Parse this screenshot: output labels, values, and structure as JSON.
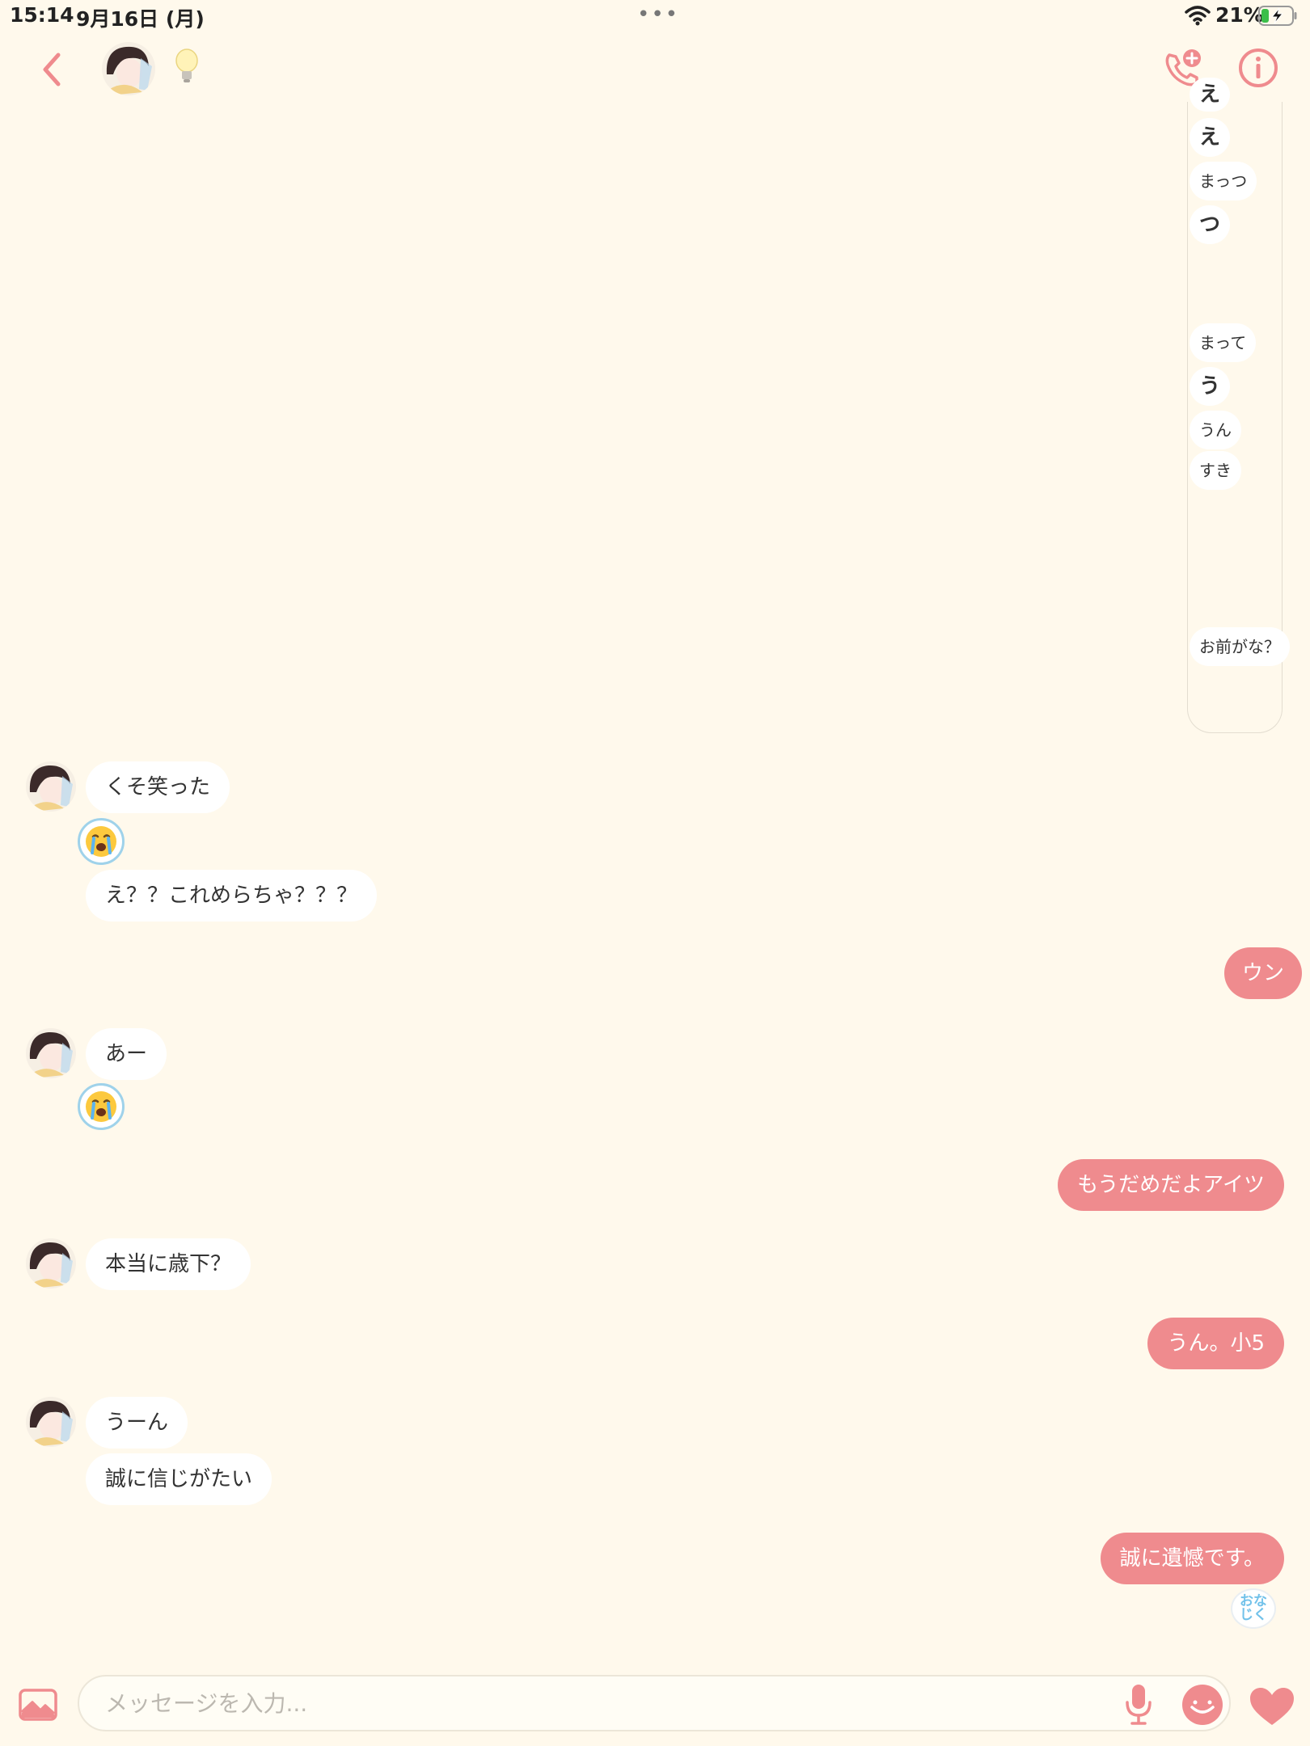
{
  "status_bar": {
    "time": "15:14",
    "date": "9月16日 (月)",
    "battery_percent": "21%",
    "battery_level": 0.21,
    "charging": true
  },
  "header": {
    "back_icon": "chevron-left-icon",
    "avatar_icon": "avatar",
    "status_icon": "lightbulb-icon",
    "call_icon": "phone-plus-icon",
    "info_icon": "info-circle-icon"
  },
  "colors": {
    "background": "#fff9ec",
    "accent": "#ef8b8e",
    "incoming_bubble": "#ffffff",
    "outgoing_bubble": "#ef8b8e"
  },
  "thread_panel": {
    "items": [
      {
        "text": "え"
      },
      {
        "text": "え"
      },
      {
        "text": "まっつ"
      },
      {
        "text": "つ"
      },
      {
        "text": "まって"
      },
      {
        "text": "う"
      },
      {
        "text": "うん"
      },
      {
        "text": "すき"
      },
      {
        "text": "お前がな？"
      }
    ]
  },
  "messages": {
    "in_1a": "くそ笑った",
    "in_1b_emoji": "😭",
    "in_1c": "え？？これめらちゃ？？？",
    "out_1": "ウン",
    "in_2a": "あー",
    "in_2b_emoji": "😭",
    "out_2": "もうだめだよアイツ",
    "in_3": "本当に歳下？",
    "out_3": "うん。小5",
    "in_4a": "うーん",
    "in_4b": "誠に信じがたい",
    "out_4": "誠に遺憾です。",
    "omikuji_label": "おな\nじく"
  },
  "input_bar": {
    "placeholder": "メッセージを入力...",
    "image_icon": "image-icon",
    "mic_icon": "microphone-icon",
    "sticker_icon": "smile-sticker-icon",
    "like_icon": "heart-icon"
  }
}
